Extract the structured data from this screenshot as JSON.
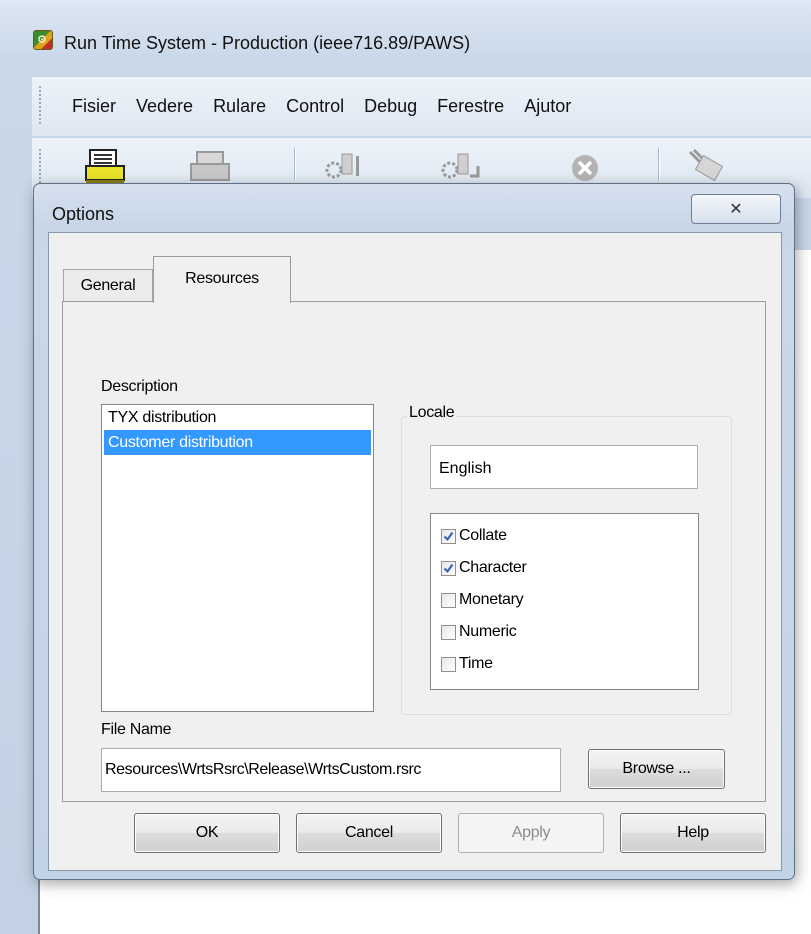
{
  "window": {
    "title": "Run Time System - Production (ieee716.89/PAWS)",
    "icon": "app-icon"
  },
  "menu": {
    "items": [
      {
        "label": "Fisier"
      },
      {
        "label": "Vedere"
      },
      {
        "label": "Rulare"
      },
      {
        "label": "Control"
      },
      {
        "label": "Debug"
      },
      {
        "label": "Ferestre"
      },
      {
        "label": "Ajutor"
      }
    ]
  },
  "toolbar": {
    "buttons": [
      {
        "icon": "load-icon"
      },
      {
        "icon": "unload-icon"
      },
      {
        "icon": "run-icon"
      },
      {
        "icon": "start-at-icon"
      },
      {
        "icon": "halt-icon"
      },
      {
        "icon": "tools-icon"
      }
    ]
  },
  "dialog": {
    "title": "Options",
    "close_glyph": "✕",
    "tabs": [
      {
        "label": "General",
        "active": false
      },
      {
        "label": "Resources",
        "active": true
      }
    ],
    "resources": {
      "description_label": "Description",
      "description_items": [
        {
          "label": "TYX distribution",
          "selected": false
        },
        {
          "label": "Customer distribution",
          "selected": true
        }
      ],
      "locale_label": "Locale",
      "locale_value": "English",
      "locale_categories": [
        {
          "label": "Collate",
          "checked": true
        },
        {
          "label": "Character",
          "checked": true
        },
        {
          "label": "Monetary",
          "checked": false
        },
        {
          "label": "Numeric",
          "checked": false
        },
        {
          "label": "Time",
          "checked": false
        }
      ],
      "file_name_label": "File Name",
      "file_name_value": "Resources\\WrtsRsrc\\Release\\WrtsCustom.rsrc",
      "browse_label": "Browse ..."
    },
    "buttons": {
      "ok": "OK",
      "cancel": "Cancel",
      "apply": "Apply",
      "help": "Help"
    }
  },
  "colors": {
    "selection": "#3399ff",
    "check": "#2a5fb8",
    "dialog_frame": "#c3d3e6"
  }
}
